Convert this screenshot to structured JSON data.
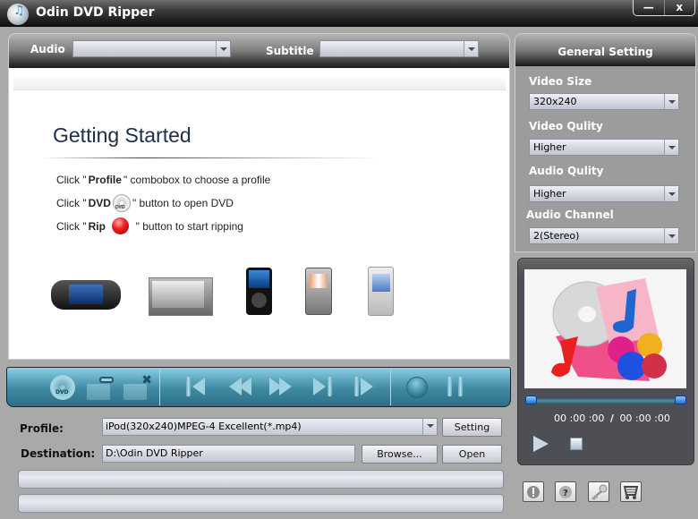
{
  "window": {
    "title": "Odin DVD Ripper",
    "minimize_label": "—",
    "close_label": "x"
  },
  "header": {
    "audio_label": "Audio",
    "audio_value": "",
    "subtitle_label": "Subtitle",
    "subtitle_value": ""
  },
  "getting_started": {
    "title": "Getting Started",
    "steps": [
      {
        "prefix": "Click \"",
        "bold": "Profile",
        "suffix": "\" combobox to choose a profile",
        "icon": ""
      },
      {
        "prefix": "Click \"",
        "bold": "DVD",
        "suffix": "\" button to open DVD",
        "icon": "dvd-disc-icon"
      },
      {
        "prefix": "Click \"",
        "bold": "Rip",
        "suffix": "\" button to start ripping",
        "icon": "rip-red-icon"
      }
    ],
    "devices": [
      "psp",
      "archos-media-player",
      "ipod",
      "smartphone-e61",
      "nokia-n95"
    ]
  },
  "toolbar": {
    "buttons": [
      "open-dvd",
      "load-folder",
      "remove-folder",
      "previous-chapter",
      "rewind",
      "fast-forward",
      "next-chapter",
      "step-frame",
      "rip",
      "pause"
    ]
  },
  "output": {
    "profile_label": "Profile:",
    "profile_value": "iPod(320x240)MPEG-4 Excellent(*.mp4)",
    "setting_button": "Setting",
    "destination_label": "Destination:",
    "destination_value": "D:\\Odin DVD Ripper",
    "browse_button": "Browse...",
    "open_button": "Open"
  },
  "general_setting": {
    "title": "General Setting",
    "video_size_label": "Video Size",
    "video_size_value": "320x240",
    "video_quality_label": "Video Qulity",
    "video_quality_value": "Higher",
    "audio_quality_label": "Audio Qulity",
    "audio_quality_value": "Higher",
    "audio_channel_label": "Audio Channel",
    "audio_channel_value": "2(Stereo)"
  },
  "preview": {
    "current_time": "00 :00 :00",
    "separator": "/",
    "total_time": "00 :00 :00"
  },
  "bottom_icons": [
    "about-icon",
    "help-icon",
    "register-key-icon",
    "buy-cart-icon"
  ]
}
